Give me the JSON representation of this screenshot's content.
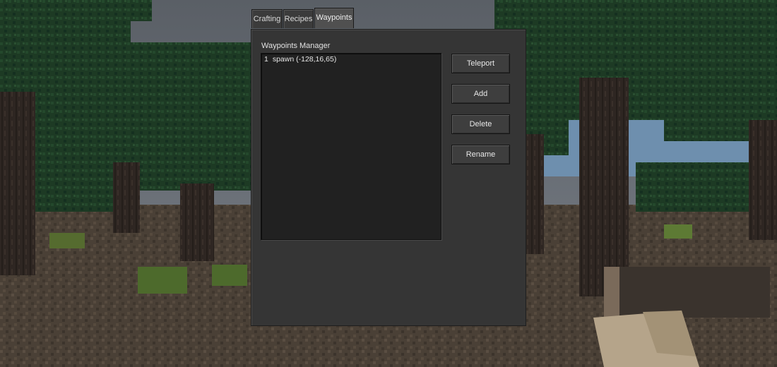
{
  "tabs": [
    {
      "label": "Crafting",
      "active": false
    },
    {
      "label": "Recipes",
      "active": false
    },
    {
      "label": "Waypoints",
      "active": true
    }
  ],
  "panel": {
    "title": "Waypoints Manager",
    "waypoints": [
      {
        "index": "1",
        "label": "spawn (-128,16,65)"
      }
    ],
    "buttons": {
      "teleport": "Teleport",
      "add": "Add",
      "delete": "Delete",
      "rename": "Rename"
    }
  },
  "colors": {
    "panel_bg": "#353535",
    "list_bg": "#212121",
    "button_bg": "#3e3e3e",
    "text": "#e6e6e6"
  }
}
